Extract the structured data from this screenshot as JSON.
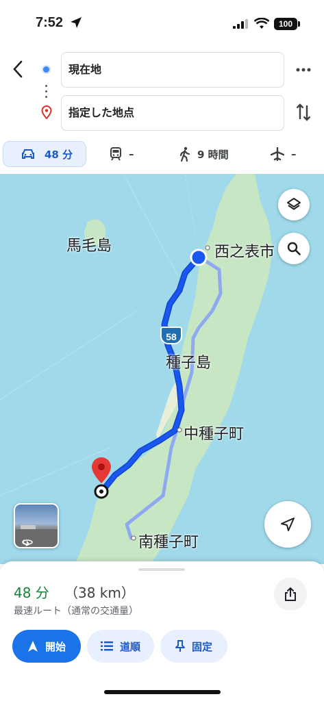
{
  "status_bar": {
    "time": "7:52",
    "battery": "100"
  },
  "directions": {
    "origin": "現在地",
    "destination": "指定した地点"
  },
  "modes": {
    "car": "48 分",
    "transit": "–",
    "walk": "9 時間",
    "flight": "–"
  },
  "map": {
    "labels": {
      "mage_island": "馬毛島",
      "nishinoomote": "西之表市",
      "tanegashima": "種子島",
      "nakatane": "中種子町",
      "minamitane": "南種子町"
    },
    "route_number": "58",
    "colors": {
      "water": "#9fd9ea",
      "land": "#c7e6c4",
      "route": "#1a56f0",
      "alt_route": "#8fa9f0"
    }
  },
  "sheet": {
    "duration": "48 分",
    "distance": "（38 km）",
    "route_description": "最速ルート（通常の交通量）",
    "start_label": "開始",
    "steps_label": "道順",
    "pin_label": "固定"
  }
}
